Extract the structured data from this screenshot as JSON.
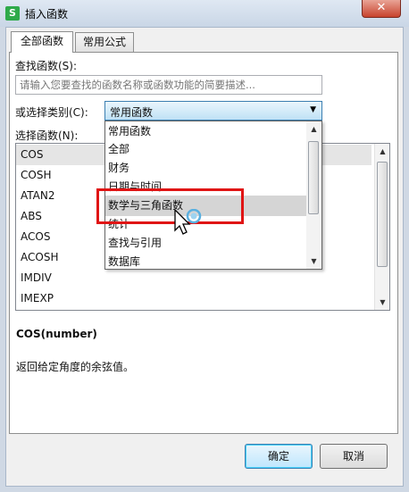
{
  "window": {
    "title": "插入函数",
    "app_icon_letter": "S",
    "close_glyph": "✕"
  },
  "tabs": [
    {
      "label": "全部函数",
      "active": true
    },
    {
      "label": "常用公式",
      "active": false
    }
  ],
  "search": {
    "label": "查找函数(S):",
    "placeholder": "请输入您要查找的函数名称或函数功能的简要描述..."
  },
  "category": {
    "label": "或选择类别(C):",
    "selected": "常用函数",
    "options": [
      "常用函数",
      "全部",
      "财务",
      "日期与时间",
      "数学与三角函数",
      "统计",
      "查找与引用",
      "数据库"
    ],
    "hovered": "数学与三角函数"
  },
  "function_list": {
    "label": "选择函数(N):",
    "items": [
      "COS",
      "COSH",
      "ATAN2",
      "ABS",
      "ACOS",
      "ACOSH",
      "IMDIV",
      "IMEXP"
    ],
    "selected": "COS"
  },
  "detail": {
    "syntax": "COS(number)",
    "description": "返回给定角度的余弦值。"
  },
  "buttons": {
    "ok": "确定",
    "cancel": "取消"
  },
  "colors": {
    "highlight": "#e01515",
    "accent": "#3c7fb1"
  }
}
